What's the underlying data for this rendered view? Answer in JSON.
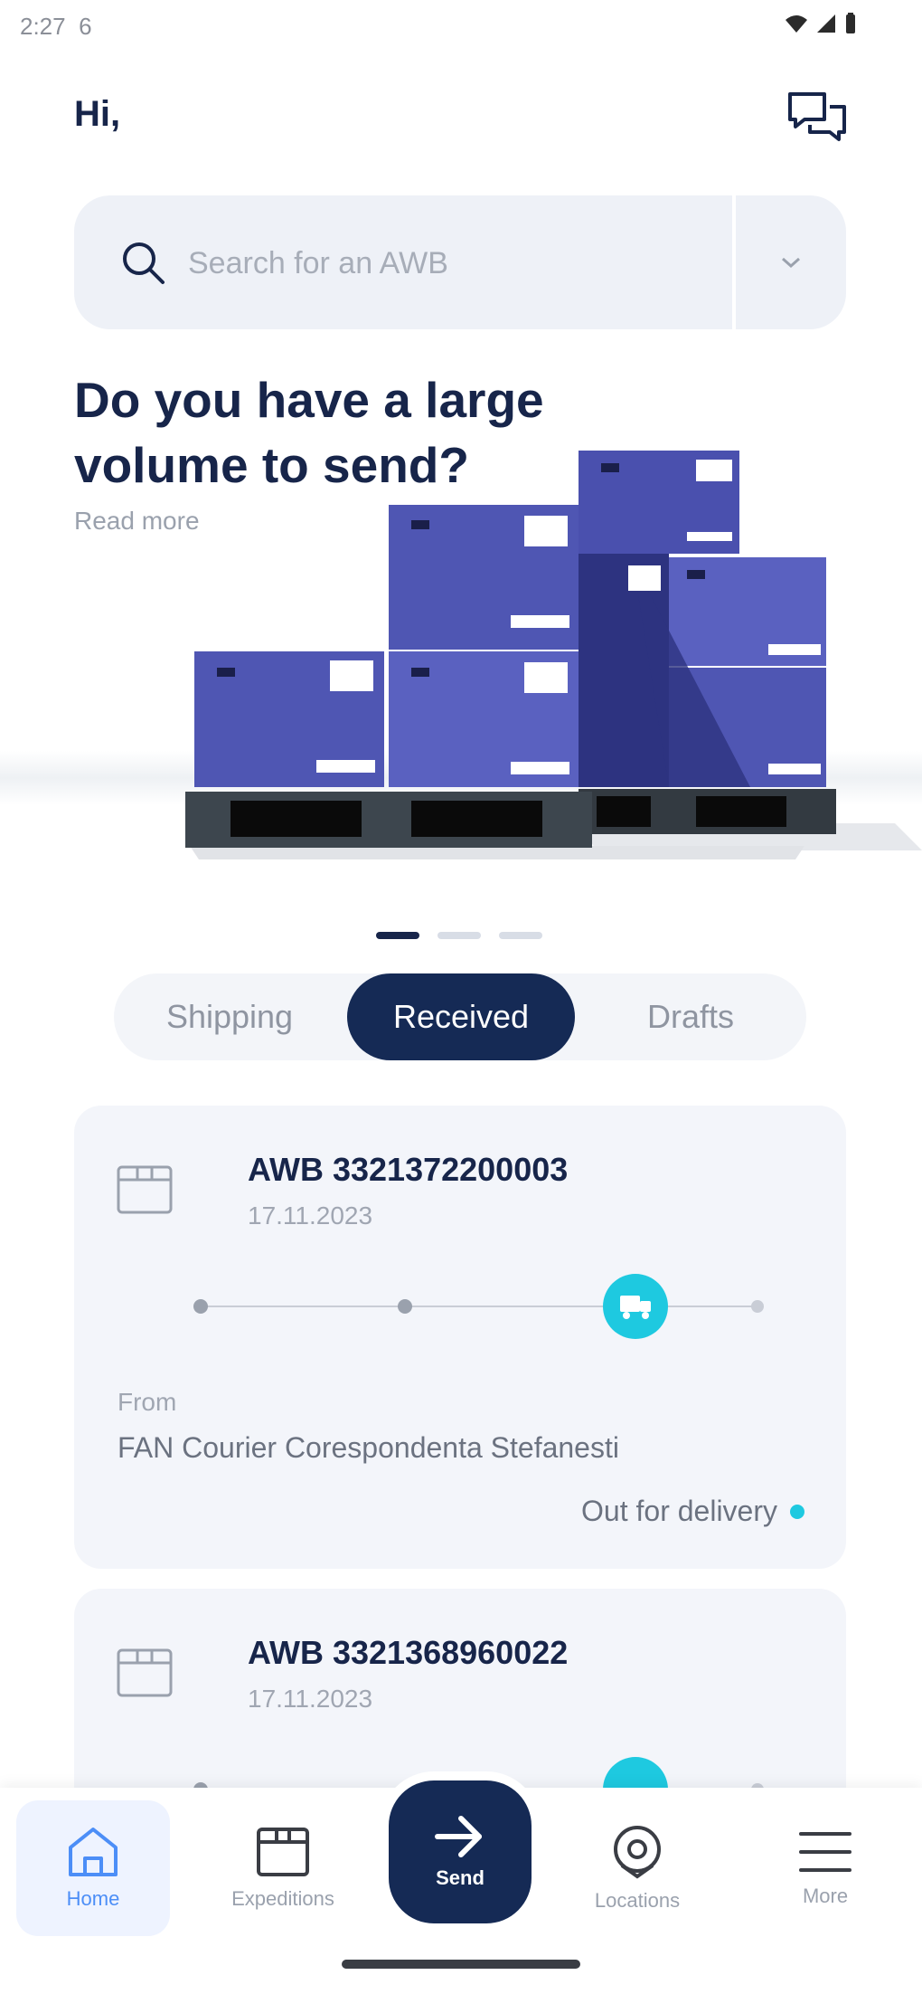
{
  "status_bar": {
    "time": "2:27",
    "extra": "6"
  },
  "header": {
    "greeting": "Hi,"
  },
  "search": {
    "placeholder": "Search for an AWB"
  },
  "banner": {
    "title": "Do you have a large volume to send?",
    "link": "Read more"
  },
  "carousel": {
    "pages": 3,
    "active": 1
  },
  "tabs": [
    {
      "label": "Shipping"
    },
    {
      "label": "Received",
      "selected": true
    },
    {
      "label": "Drafts"
    }
  ],
  "shipments": [
    {
      "awb": "AWB 3321372200003",
      "date": "17.11.2023",
      "progress_step": 3,
      "steps_total": 4,
      "from_label": "From",
      "from": "FAN Courier Corespondenta Stefanesti",
      "status": "Out for delivery"
    },
    {
      "awb": "AWB 3321368960022",
      "date": "17.11.2023",
      "progress_step": 3,
      "steps_total": 4
    }
  ],
  "nav": {
    "home": "Home",
    "expeditions": "Expeditions",
    "send": "Send",
    "locations": "Locations",
    "more": "More"
  },
  "colors": {
    "primary": "#152a55",
    "accent": "#1ec9e0",
    "home_active": "#4c8ef7",
    "box_blue": "#4f56b3"
  }
}
